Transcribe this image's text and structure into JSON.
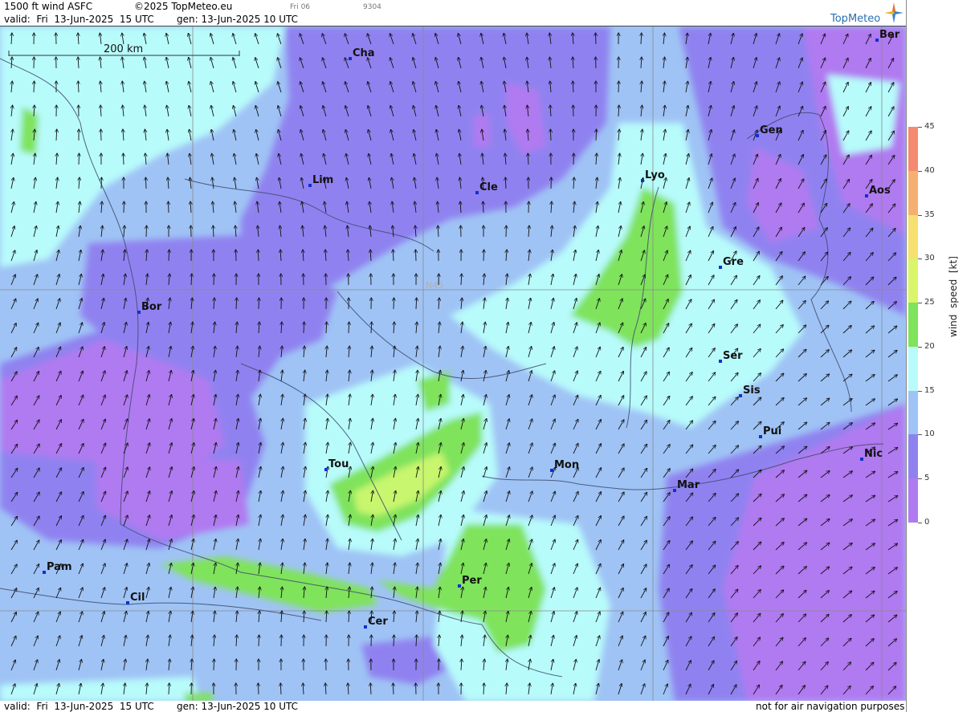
{
  "header": {
    "product": "1500 ft wind ASFC",
    "copyright": "©2025 TopMeteo.eu",
    "valid": "valid:  Fri  13-Jun-2025  15 UTC",
    "gen": "gen: 13-Jun-2025 10 UTC",
    "small_1": "Fri 06",
    "small_2": "9304",
    "brand": "TopMeteo"
  },
  "footer": {
    "valid": "valid:  Fri  13-Jun-2025  15 UTC",
    "gen": "gen: 13-Jun-2025 10 UTC",
    "disclaimer": "not for air navigation purposes"
  },
  "map": {
    "scale_label": "200 km",
    "lat_label": "N45",
    "cities": [
      {
        "name": "Cha"
      },
      {
        "name": "Ber"
      },
      {
        "name": "Lim"
      },
      {
        "name": "Cle"
      },
      {
        "name": "Lyo"
      },
      {
        "name": "Gen"
      },
      {
        "name": "Aos"
      },
      {
        "name": "Gre"
      },
      {
        "name": "Bor"
      },
      {
        "name": "Ser"
      },
      {
        "name": "Sis"
      },
      {
        "name": "Pui"
      },
      {
        "name": "Nic"
      },
      {
        "name": "Tou"
      },
      {
        "name": "Mon"
      },
      {
        "name": "Mar"
      },
      {
        "name": "Pam"
      },
      {
        "name": "Cil"
      },
      {
        "name": "Per"
      },
      {
        "name": "Cer"
      }
    ]
  },
  "legend": {
    "title": "wind  speed  [kt]",
    "ticks": [
      "45",
      "40",
      "35",
      "30",
      "25",
      "20",
      "15",
      "10",
      "5",
      "0"
    ],
    "colors": [
      "#f58a70",
      "#f5b070",
      "#f5e070",
      "#d9f56a",
      "#7fe35c",
      "#b8fbfb",
      "#9fc3f5",
      "#8f82f0",
      "#b07af0"
    ]
  }
}
